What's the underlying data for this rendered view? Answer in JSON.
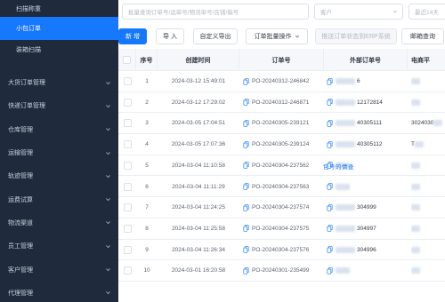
{
  "sidebar": {
    "sub_items": [
      {
        "label": "扫描称重",
        "active": false
      },
      {
        "label": "小包订单",
        "active": true
      },
      {
        "label": "装箱扫描",
        "active": false
      }
    ],
    "groups": [
      {
        "label": "大货订单管理"
      },
      {
        "label": "快递订单管理"
      },
      {
        "label": "仓库管理"
      },
      {
        "label": "运输管理"
      },
      {
        "label": "轨迹管理"
      },
      {
        "label": "运费试算"
      },
      {
        "label": "物流渠道"
      },
      {
        "label": "员工管理"
      },
      {
        "label": "客户管理"
      },
      {
        "label": "代理管理"
      }
    ]
  },
  "filters": {
    "search_placeholder": "批量查询订单号/运单号/物流单号/店铺/箱号",
    "customer_placeholder": "客户",
    "date_placeholder": "最近14天"
  },
  "toolbar": {
    "new_label": "新 增",
    "import_label": "导 入",
    "export_label": "自定义导出",
    "batch_label": "订单批量操作",
    "erp_label": "推送订单状态到ERP系统",
    "mail_label": "邮箱查询"
  },
  "table": {
    "headers": {
      "index": "序号",
      "created": "创建时间",
      "order_no": "订单号",
      "external_no": "外部订单号",
      "platform": "电商平"
    },
    "rows": [
      {
        "index": "1",
        "created": "2024-03-12 15:49:01",
        "order_no": "PO-20240312-246842",
        "external_no": "6"
      },
      {
        "index": "2",
        "created": "2024-03-12 17:29:02",
        "order_no": "PO-20240312-246871",
        "external_no": "12172814"
      },
      {
        "index": "3",
        "created": "2024-03-05 17:04:51",
        "order_no": "PO-20240305-239121",
        "external_no": "40305111"
      },
      {
        "index": "4",
        "created": "2024-03-05 17:07:36",
        "order_no": "PO-20240305-239124",
        "external_no": "40305112"
      },
      {
        "index": "5",
        "created": "2024-03-04 11:10:58",
        "order_no": "PO-20240304-237562",
        "external_no": ""
      },
      {
        "index": "6",
        "created": "2024-03-04 11:11:29",
        "order_no": "PO-20240304-237563",
        "external_no": ""
      },
      {
        "index": "7",
        "created": "2024-03-04 11:24:25",
        "order_no": "PO-20240304-237574",
        "external_no": "304999"
      },
      {
        "index": "8",
        "created": "2024-03-04 11:25:58",
        "order_no": "PO-20240304-237575",
        "external_no": "304997"
      },
      {
        "index": "9",
        "created": "2024-03-04 11:26:34",
        "order_no": "PO-20240304-237576",
        "external_no": "304996"
      },
      {
        "index": "10",
        "created": "2024-03-01 16:20:58",
        "order_no": "PO-20240301-235499",
        "external_no": ""
      }
    ],
    "platform_visible": [
      "",
      "",
      "3024030",
      "T",
      "",
      "",
      "",
      "",
      "",
      ""
    ],
    "row2_note": "包号的情查"
  },
  "colors": {
    "sidebar_bg": "#1f2a3d",
    "accent": "#1677ff",
    "border": "#ebeef5"
  }
}
